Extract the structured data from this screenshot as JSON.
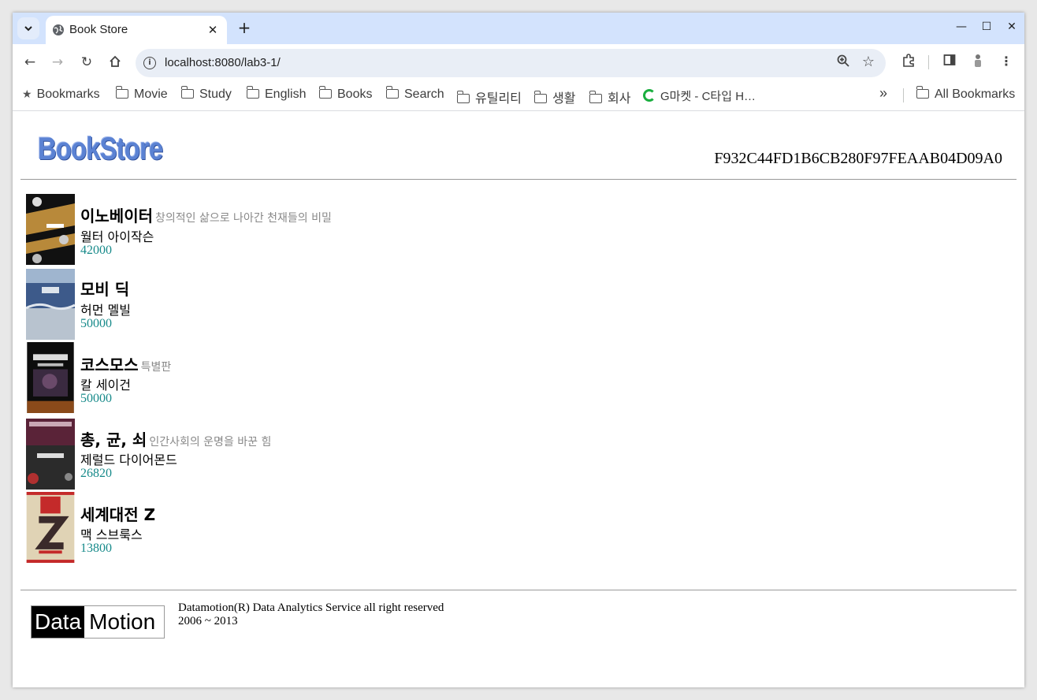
{
  "browser": {
    "tab_title": "Book Store",
    "url": "localhost:8080/lab3-1/",
    "bookmarks": [
      "Bookmarks",
      "Movie",
      "Study",
      "English",
      "Books",
      "Search",
      "유틸리티",
      "생활",
      "회사",
      "G마켓 - C타입 H…"
    ],
    "all_bookmarks": "All Bookmarks",
    "overflow": "»"
  },
  "page": {
    "logo": "BookStore",
    "session_id": "F932C44FD1B6CB280F97FEAAB04D09A0",
    "books": [
      {
        "title": "이노베이터",
        "subtitle": "창의적인 삶으로 나아간 천재들의 비밀",
        "author": "월터 아이작슨",
        "price": "42000"
      },
      {
        "title": "모비 딕",
        "subtitle": "",
        "author": "허먼 멜빌",
        "price": "50000"
      },
      {
        "title": "코스모스",
        "subtitle": "특별판",
        "author": "칼 세이건",
        "price": "50000"
      },
      {
        "title": "총, 균, 쇠",
        "subtitle": "인간사회의 운명을 바꾼 힘",
        "author": "제럴드 다이어몬드",
        "price": "26820"
      },
      {
        "title": "세계대전 Z",
        "subtitle": "",
        "author": "맥 스브룩스",
        "price": "13800"
      }
    ],
    "footer": {
      "logo_part1": "Data",
      "logo_part2": "Motion",
      "line1": "Datamotion(R) Data Analytics Service all right reserved",
      "line2": "2006 ~ 2013"
    }
  }
}
